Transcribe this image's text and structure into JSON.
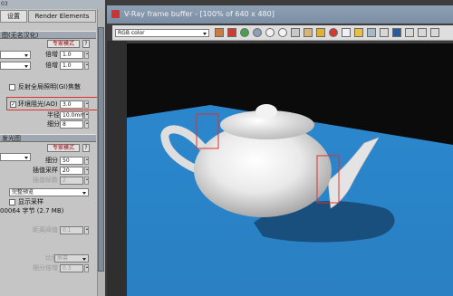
{
  "window": {
    "topbar_text": "03",
    "vfb_title": "V-Ray frame buffer - [100% of 640 x 480]",
    "channel_select": "RGB color"
  },
  "panel": {
    "tabs": [
      "设置",
      "Render Elements"
    ],
    "rollout1": {
      "title": "图(无名汉化)",
      "mode": "专家模式",
      "help": "?"
    },
    "fields1": [
      {
        "label": "倍增",
        "value": "1.0"
      },
      {
        "label": "倍增",
        "value": "1.0"
      }
    ],
    "gi_caustics": "反射全局照明(GI)焦散",
    "ao": {
      "checked": "✓",
      "label": "环境阻光(AO)",
      "value": "3.0"
    },
    "radius": {
      "label": "半径",
      "value": "10.0mm"
    },
    "subdivs": {
      "label": "细分",
      "value": "8"
    },
    "rollout2": {
      "title": "发光图",
      "mode": "专家模式",
      "help": "?"
    },
    "subdivs2": {
      "label": "细分",
      "value": "50"
    },
    "interp": {
      "label": "插值采样",
      "value": "20"
    },
    "interp_frames": {
      "label": "插值帧数",
      "value": "2"
    },
    "full_preview": "完整预览",
    "show_samples": "显示采样",
    "memory": "00064 字节 (2.7 MB)",
    "dist_thresh": {
      "label": "距离阈值",
      "value": "0.1"
    },
    "scale": {
      "label": "比例",
      "value": "屏幕"
    },
    "subdivs_mult": {
      "label": "细分倍增",
      "value": "0.3"
    }
  },
  "colors": {
    "floor": "#2a86cc",
    "annotation_red": "#e0302a",
    "panel_bg": "#c5c5c5"
  },
  "icons": [
    "color-swatch-icon",
    "red-channel-icon",
    "green-channel-icon",
    "blue-channel-icon",
    "save-icon",
    "clear-icon",
    "region-icon",
    "render-icon",
    "lens-icon",
    "settings-icon"
  ]
}
